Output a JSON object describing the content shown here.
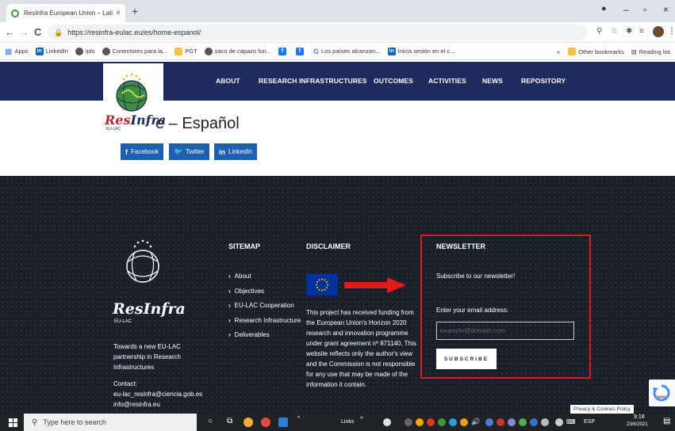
{
  "browser": {
    "tab_title": "ResInfra European Union – Latin",
    "tab_close": "×",
    "new_tab": "+",
    "minimize": "–",
    "maximize": "▫",
    "close": "×",
    "back": "←",
    "forward": "→",
    "reload": "C",
    "url": "https://resinfra-eulac.eu/es/home-espanol/",
    "bookmarks": [
      {
        "label": "Apps",
        "icon": "apps-grid-icon"
      },
      {
        "label": "LinkedIn",
        "icon": "linkedin-icon"
      },
      {
        "label": "iplo",
        "icon": "globe-icon"
      },
      {
        "label": "Conectores para la...",
        "icon": "globe-icon"
      },
      {
        "label": "PGT",
        "icon": "folder-icon"
      },
      {
        "label": "saco de capazo fun...",
        "icon": "globe-icon"
      },
      {
        "label": "",
        "icon": "facebook-icon"
      },
      {
        "label": "",
        "icon": "facebook-icon"
      },
      {
        "label": "Los países alcanzan...",
        "icon": "google-icon"
      },
      {
        "label": "Inicia sesión en el c...",
        "icon": "linkedin-icon"
      }
    ],
    "bookmarks_overflow": "»",
    "other_bookmarks": "Other bookmarks",
    "reading_list": "Reading list"
  },
  "site": {
    "nav": [
      "ABOUT",
      "RESEARCH INFRASTRUCTURES",
      "OUTCOMES",
      "ACTIVITIES",
      "NEWS",
      "REPOSITORY"
    ],
    "logo_text_res": "Res",
    "logo_text_infra": "Infra",
    "logo_sub": "EU-LAC",
    "page_title": "e – Español",
    "share": [
      {
        "label": "Facebook",
        "icon": "f"
      },
      {
        "label": "Twitter",
        "icon": "🐦"
      },
      {
        "label": "LinkedIn",
        "icon": "in"
      }
    ]
  },
  "footer": {
    "logo_word": "ResInfra",
    "logo_sub": "EU-LAC",
    "tagline": [
      "Towards a new EU-LAC",
      "partnership in Research",
      "Infrastructures"
    ],
    "contact_label": "Contact:",
    "contact_emails": [
      "eu-lac_resinfra@ciencia.gob.es",
      "info@resinfra.eu"
    ],
    "sitemap_title": "SITEMAP",
    "sitemap_links": [
      "About",
      "Objectives",
      "EU-LAC Cooperation",
      "Research Infrastructure",
      "Deliverables"
    ],
    "disclaimer_title": "DISCLAIMER",
    "disclaimer_lines": [
      "This project has received funding from",
      "the European Union's Horizon 2020",
      "research and innovation programme",
      "under grant agreement nº 871140. This",
      "website reflects only the author's view",
      "and the Commission is not responsible",
      "for any use that may be made of the",
      "information it contain."
    ],
    "newsletter_title": "NEWSLETTER",
    "newsletter_subtitle": "Subscribe to our newsletter!",
    "email_label": "Enter your email address:",
    "email_placeholder": "example@domain.com",
    "subscribe_label": "SUBSCRIBE",
    "privacy": "Privacy & Cookies Policy"
  },
  "taskbar": {
    "search_placeholder": "Type here to search",
    "links_label": "Links",
    "language": "ESP",
    "time": "9:18",
    "date": "23/6/2021"
  },
  "colors": {
    "nav_bg": "#1d2b5e",
    "footer_bg": "#1b1f2a",
    "share_bg": "#1d5fb2",
    "highlight_red": "#e01b1b"
  }
}
